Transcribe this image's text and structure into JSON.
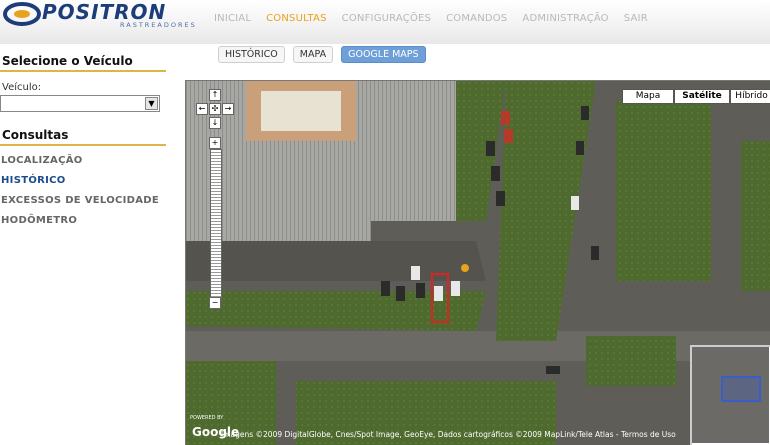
{
  "header": {
    "logo_name": "POSITRON",
    "logo_sub": "RASTREADORES",
    "nav": [
      "INICIAL",
      "CONSULTAS",
      "CONFIGURAÇÕES",
      "COMANDOS",
      "ADMINISTRAÇÃO",
      "SAIR"
    ],
    "active_nav": "CONSULTAS"
  },
  "tabs": [
    "HISTÓRICO",
    "MAPA",
    "GOOGLE MAPS"
  ],
  "active_tab": "GOOGLE MAPS",
  "sidebar": {
    "select_title": "Selecione o Veículo",
    "vehicle_label": "Veículo:",
    "vehicle_value": "",
    "consultas_title": "Consultas",
    "menu": [
      "LOCALIZAÇÃO",
      "HISTÓRICO",
      "EXCESSOS DE VELOCIDADE",
      "HODÔMETRO"
    ],
    "active_menu": "HISTÓRICO"
  },
  "map": {
    "type_buttons": [
      "Mapa",
      "Satélite",
      "Híbrido"
    ],
    "controls": [
      "↑",
      "←",
      "✣",
      "→",
      "↓",
      "+",
      "−"
    ],
    "powered_by": "POWERED BY",
    "google": "Google",
    "copyright": "Imagens ©2009 DigitalGlobe, Cnes/Spot Image, GeoEye, Dados cartográficos ©2009 MapLink/Tele Atlas - Termos de Uso",
    "marker_color": "#dd2222"
  },
  "colors": {
    "accent": "#e7a21e",
    "nav_inactive": "#b8b8b8",
    "tab_active": "#6f9fd8",
    "logo": "#1c3d7a"
  }
}
